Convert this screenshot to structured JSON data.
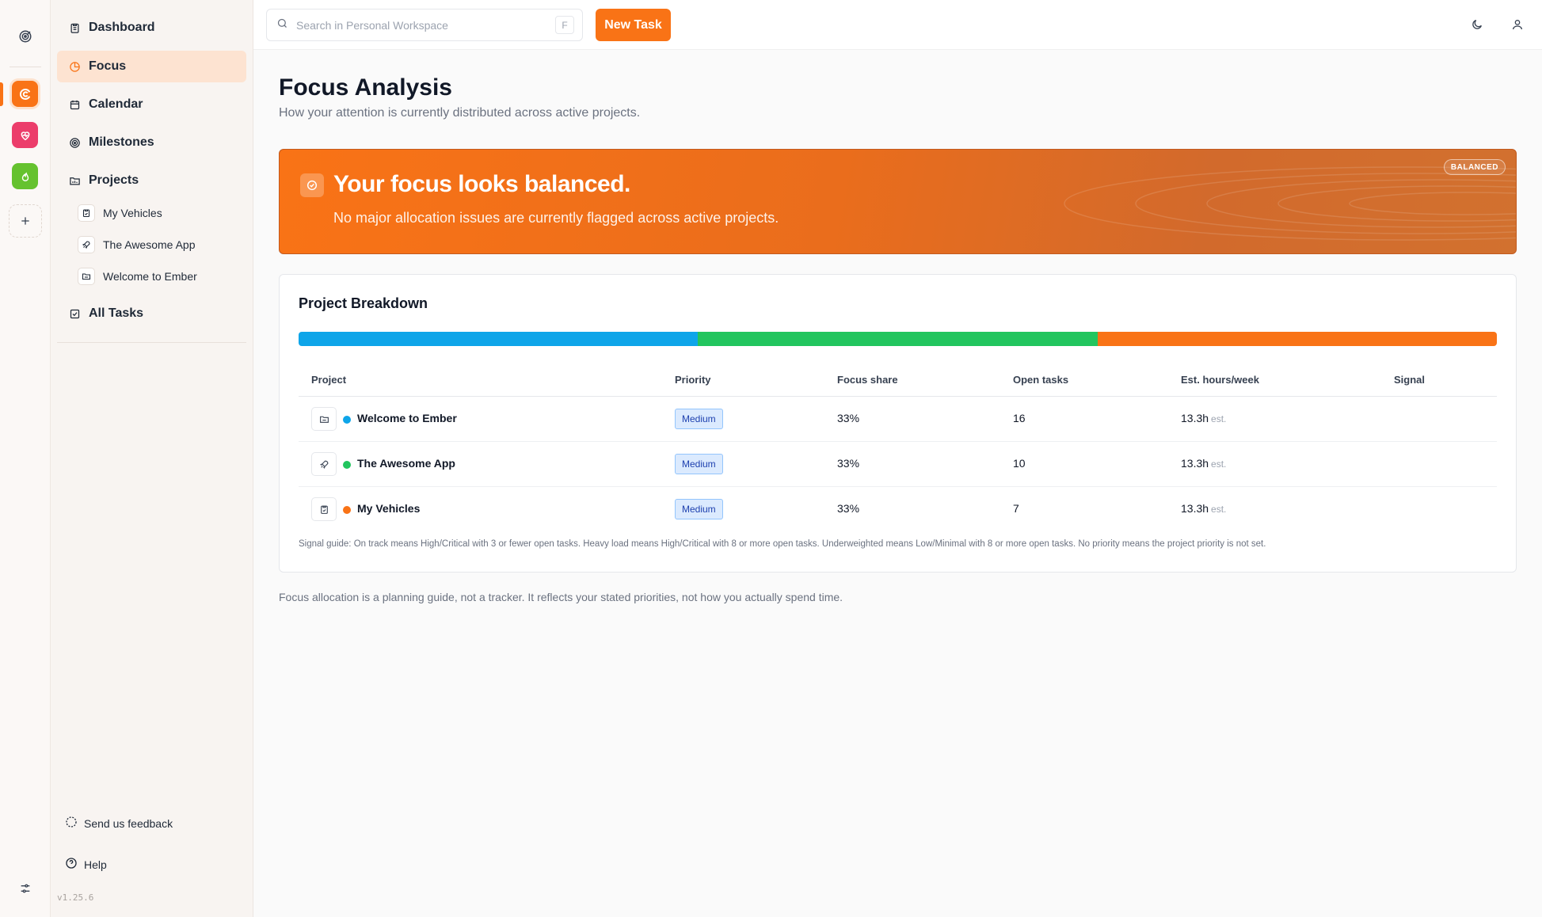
{
  "rail": {
    "workspaces": [
      {
        "name": "Ember",
        "color": "#f97316",
        "icon": "ember-icon"
      },
      {
        "name": "Health",
        "color": "#ec3d6b",
        "icon": "heart-icon"
      },
      {
        "name": "Fire",
        "color": "#65c22f",
        "icon": "flame-icon"
      }
    ]
  },
  "sidebar": {
    "items": [
      {
        "label": "Dashboard",
        "icon": "clipboard-icon"
      },
      {
        "label": "Focus",
        "icon": "pie-icon",
        "active": true
      },
      {
        "label": "Calendar",
        "icon": "calendar-icon"
      },
      {
        "label": "Milestones",
        "icon": "target-icon"
      },
      {
        "label": "Projects",
        "icon": "folder-icon"
      }
    ],
    "projects": [
      {
        "label": "My Vehicles",
        "icon": "clipboard-check-icon"
      },
      {
        "label": "The Awesome App",
        "icon": "rocket-icon"
      },
      {
        "label": "Welcome to Ember",
        "icon": "folder-icon"
      }
    ],
    "all_tasks": "All Tasks",
    "feedback": "Send us feedback",
    "help": "Help",
    "version": "v1.25.6"
  },
  "topbar": {
    "search_placeholder": "Search in Personal Workspace",
    "search_shortcut": "F",
    "new_task": "New Task"
  },
  "page": {
    "title": "Focus Analysis",
    "subtitle": "How your attention is currently distributed across active projects."
  },
  "banner": {
    "title": "Your focus looks balanced.",
    "subtitle": "No major allocation issues are currently flagged across active projects.",
    "badge": "BALANCED"
  },
  "breakdown": {
    "title": "Project Breakdown",
    "allocation": [
      {
        "project": "Welcome to Ember",
        "share": 33.33,
        "color": "#0ea5e9"
      },
      {
        "project": "The Awesome App",
        "share": 33.33,
        "color": "#22c55e"
      },
      {
        "project": "My Vehicles",
        "share": 33.34,
        "color": "#f97316"
      }
    ],
    "columns": [
      "Project",
      "Priority",
      "Focus share",
      "Open tasks",
      "Est. hours/week",
      "Signal"
    ],
    "rows": [
      {
        "name": "Welcome to Ember",
        "icon": "folder-icon",
        "color": "#0ea5e9",
        "priority": "Medium",
        "share": "33%",
        "open": "16",
        "hours": "13.3h",
        "est": "est.",
        "signal": ""
      },
      {
        "name": "The Awesome App",
        "icon": "rocket-icon",
        "color": "#22c55e",
        "priority": "Medium",
        "share": "33%",
        "open": "10",
        "hours": "13.3h",
        "est": "est.",
        "signal": ""
      },
      {
        "name": "My Vehicles",
        "icon": "clipboard-check-icon",
        "color": "#f97316",
        "priority": "Medium",
        "share": "33%",
        "open": "7",
        "hours": "13.3h",
        "est": "est.",
        "signal": ""
      }
    ],
    "guide": "Signal guide: On track means High/Critical with 3 or fewer open tasks. Heavy load means High/Critical with 8 or more open tasks. Underweighted means Low/Minimal with 8 or more open tasks. No priority means the project priority is not set."
  },
  "footnote": "Focus allocation is a planning guide, not a tracker. It reflects your stated priorities, not how you actually spend time."
}
